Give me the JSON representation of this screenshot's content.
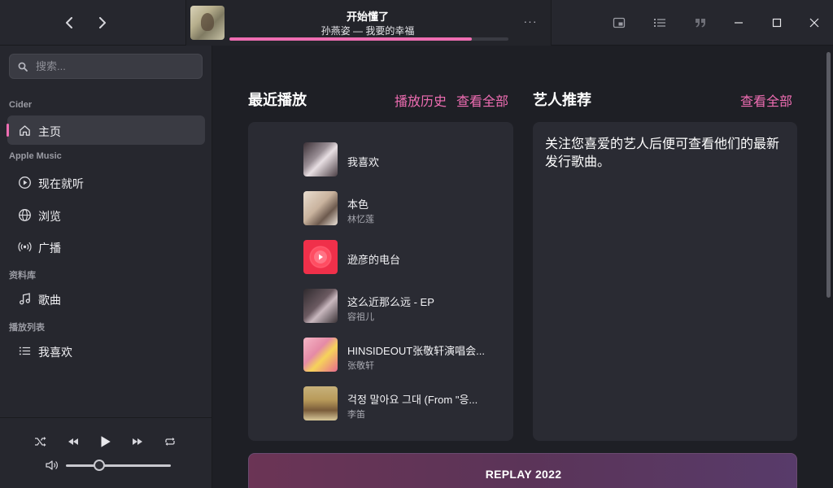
{
  "theme": {
    "accent": "#ee6db2",
    "background": "#1e1f25",
    "panel": "#26272e",
    "card": "#2a2b33"
  },
  "titlebar": {
    "back_icon": "chevron-left-icon",
    "forward_icon": "chevron-right-icon",
    "now_playing": {
      "title": "开始懂了",
      "subtitle": "孙燕姿 — 我要的幸福",
      "progress": 0.87,
      "more_label": "···"
    },
    "icons": [
      "miniplayer-icon",
      "queue-list-icon",
      "lyrics-quote-icon"
    ],
    "window_controls": [
      "minimize-icon",
      "maximize-icon",
      "close-icon"
    ]
  },
  "sidebar": {
    "search": {
      "placeholder": "搜索...",
      "value": ""
    },
    "sections": {
      "app": "Cider",
      "apple_music": "Apple Music",
      "library": "资料库",
      "playlists": "播放列表"
    },
    "items": {
      "home": {
        "label": "主页",
        "icon": "home-icon",
        "active": true
      },
      "listen_now": {
        "label": "现在就听",
        "icon": "play-circle-icon"
      },
      "browse": {
        "label": "浏览",
        "icon": "globe-icon"
      },
      "radio": {
        "label": "广播",
        "icon": "radio-broadcast-icon"
      },
      "songs": {
        "label": "歌曲",
        "icon": "music-note-icon"
      },
      "favorites": {
        "label": "我喜欢",
        "icon": "list-icon"
      }
    }
  },
  "player": {
    "controls": [
      "shuffle-icon",
      "previous-icon",
      "play-icon",
      "next-icon",
      "repeat-icon"
    ],
    "volume": 0.32
  },
  "main": {
    "recent": {
      "title": "最近播放",
      "history_link": "播放历史",
      "see_all": "查看全部",
      "items": [
        {
          "name": "我喜欢",
          "artist": "",
          "art_color": "#9a8f96"
        },
        {
          "name": "本色",
          "artist": "林忆莲",
          "art_color": "#d8c6b4"
        },
        {
          "name": "逊彦的电台",
          "artist": "",
          "art_color": "#f0304a"
        },
        {
          "name": "这么近那么远 - EP",
          "artist": "容祖儿",
          "art_color": "#5e4f55"
        },
        {
          "name": "HINSIDEOUT张敬轩演唱会...",
          "artist": "张敬轩",
          "art_color": "#e58aa6"
        },
        {
          "name": "걱정 말아요 그대 (From \"응...",
          "artist": "李笛",
          "art_color": "#b89a5a"
        }
      ]
    },
    "artists": {
      "title": "艺人推荐",
      "see_all": "查看全部",
      "message": "关注您喜爱的艺人后便可查看他们的最新发行歌曲。"
    },
    "replay_label": "REPLAY 2022"
  }
}
